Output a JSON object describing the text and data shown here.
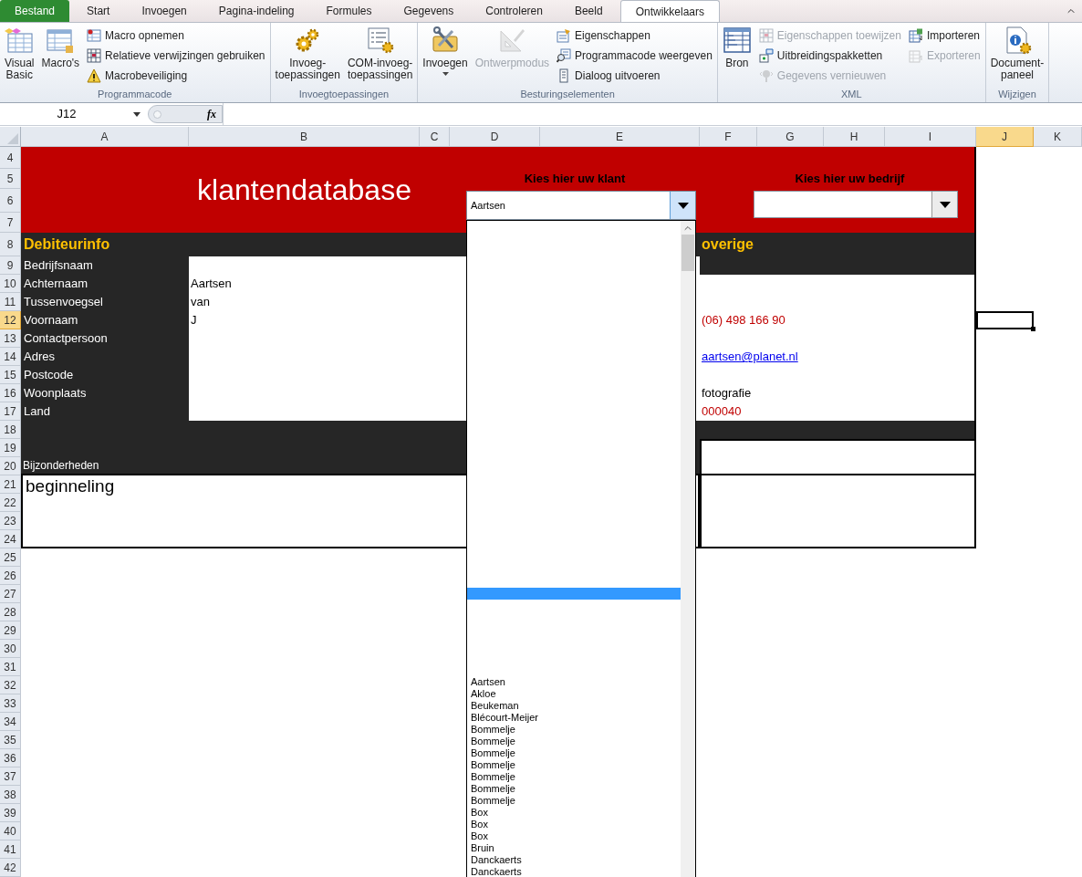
{
  "tabs": [
    {
      "label": "Bestand",
      "kind": "file",
      "selected": false
    },
    {
      "label": "Start",
      "kind": "tab",
      "selected": false
    },
    {
      "label": "Invoegen",
      "kind": "tab",
      "selected": false
    },
    {
      "label": "Pagina-indeling",
      "kind": "tab",
      "selected": false
    },
    {
      "label": "Formules",
      "kind": "tab",
      "selected": false
    },
    {
      "label": "Gegevens",
      "kind": "tab",
      "selected": false
    },
    {
      "label": "Controleren",
      "kind": "tab",
      "selected": false
    },
    {
      "label": "Beeld",
      "kind": "tab",
      "selected": false
    },
    {
      "label": "Ontwikkelaars",
      "kind": "tab",
      "selected": true
    }
  ],
  "ribbon_groups": [
    {
      "title": "Programmacode",
      "items": [
        {
          "lines": [
            "Visual",
            "Basic"
          ],
          "kind": "large",
          "disabled": false
        },
        {
          "lines": [
            "Macro's"
          ],
          "kind": "large",
          "disabled": false
        },
        {
          "lines": [
            "Macro opnemen"
          ],
          "kind": "small",
          "disabled": false
        },
        {
          "lines": [
            "Relatieve verwijzingen gebruiken"
          ],
          "kind": "small",
          "disabled": false
        },
        {
          "lines": [
            "Macrobeveiliging"
          ],
          "kind": "small",
          "disabled": false
        }
      ]
    },
    {
      "title": "Invoegtoepassingen",
      "items": [
        {
          "lines": [
            "Invoeg-",
            "toepassingen"
          ],
          "kind": "large",
          "disabled": false
        },
        {
          "lines": [
            "COM-invoeg-",
            "toepassingen"
          ],
          "kind": "large",
          "disabled": false
        }
      ]
    },
    {
      "title": "Besturingselementen",
      "items": [
        {
          "lines": [
            "Invoegen"
          ],
          "kind": "menu",
          "disabled": false
        },
        {
          "lines": [
            "Ontwerpmodus"
          ],
          "kind": "large",
          "disabled": true
        },
        {
          "lines": [
            "Eigenschappen"
          ],
          "kind": "small",
          "disabled": false
        },
        {
          "lines": [
            "Programmacode weergeven"
          ],
          "kind": "small",
          "disabled": false
        },
        {
          "lines": [
            "Dialoog uitvoeren"
          ],
          "kind": "small",
          "disabled": false
        }
      ]
    },
    {
      "title": "XML",
      "items": [
        {
          "lines": [
            "Bron"
          ],
          "kind": "large",
          "disabled": false
        },
        {
          "lines": [
            "Eigenschappen toewijzen"
          ],
          "kind": "small",
          "disabled": true
        },
        {
          "lines": [
            "Uitbreidingspakketten"
          ],
          "kind": "small",
          "disabled": false
        },
        {
          "lines": [
            "Gegevens vernieuwen"
          ],
          "kind": "small",
          "disabled": true
        },
        {
          "lines": [
            "Importeren"
          ],
          "kind": "small",
          "disabled": false
        },
        {
          "lines": [
            "Exporteren"
          ],
          "kind": "small",
          "disabled": true
        }
      ]
    },
    {
      "title": "Wijzigen",
      "items": [
        {
          "lines": [
            "Document-",
            "paneel"
          ],
          "kind": "large",
          "disabled": false
        }
      ]
    }
  ],
  "formula_bar": {
    "name_box": "J12",
    "function_button": "fx"
  },
  "sheet": {
    "columns": [
      {
        "label": "A",
        "selected": false
      },
      {
        "label": "B",
        "selected": false
      },
      {
        "label": "C",
        "selected": false
      },
      {
        "label": "D",
        "selected": false
      },
      {
        "label": "E",
        "selected": false
      },
      {
        "label": "F",
        "selected": false
      },
      {
        "label": "G",
        "selected": false
      },
      {
        "label": "H",
        "selected": false
      },
      {
        "label": "I",
        "selected": false
      },
      {
        "label": "J",
        "selected": true
      },
      {
        "label": "K",
        "selected": false
      }
    ],
    "rows": [
      {
        "label": "4",
        "selected": false
      },
      {
        "label": "5",
        "selected": false
      },
      {
        "label": "6",
        "selected": false
      },
      {
        "label": "7",
        "selected": false
      },
      {
        "label": "8",
        "selected": false
      },
      {
        "label": "9",
        "selected": false
      },
      {
        "label": "10",
        "selected": false
      },
      {
        "label": "11",
        "selected": false
      },
      {
        "label": "12",
        "selected": true
      },
      {
        "label": "13",
        "selected": false
      },
      {
        "label": "14",
        "selected": false
      },
      {
        "label": "15",
        "selected": false
      },
      {
        "label": "16",
        "selected": false
      },
      {
        "label": "17",
        "selected": false
      },
      {
        "label": "18",
        "selected": false
      },
      {
        "label": "19",
        "selected": false
      },
      {
        "label": "20",
        "selected": false
      },
      {
        "label": "21",
        "selected": false
      },
      {
        "label": "22",
        "selected": false
      },
      {
        "label": "23",
        "selected": false
      },
      {
        "label": "24",
        "selected": false
      },
      {
        "label": "25",
        "selected": false
      },
      {
        "label": "26",
        "selected": false
      },
      {
        "label": "27",
        "selected": false
      },
      {
        "label": "28",
        "selected": false
      },
      {
        "label": "29",
        "selected": false
      },
      {
        "label": "30",
        "selected": false
      },
      {
        "label": "31",
        "selected": false
      },
      {
        "label": "32",
        "selected": false
      },
      {
        "label": "33",
        "selected": false
      },
      {
        "label": "34",
        "selected": false
      },
      {
        "label": "35",
        "selected": false
      },
      {
        "label": "36",
        "selected": false
      },
      {
        "label": "37",
        "selected": false
      },
      {
        "label": "38",
        "selected": false
      },
      {
        "label": "39",
        "selected": false
      },
      {
        "label": "40",
        "selected": false
      },
      {
        "label": "41",
        "selected": false
      },
      {
        "label": "42",
        "selected": false
      }
    ],
    "title": "klantendatabase",
    "customer_picker": {
      "label": "Kies hier uw klant",
      "value": "Aartsen",
      "open": true
    },
    "company_picker": {
      "label": "Kies hier uw bedrijf",
      "open": false
    },
    "debtor_heading": "Debiteurinfo",
    "debtor_fields": [
      {
        "label": "Bedrijfsnaam"
      },
      {
        "label": "Achternaam",
        "value": "Aartsen"
      },
      {
        "label": "Tussenvoegsel",
        "value": "van"
      },
      {
        "label": "Voornaam",
        "value": "J"
      },
      {
        "label": "Contactpersoon"
      },
      {
        "label": "Adres"
      },
      {
        "label": "Postcode"
      },
      {
        "label": "Woonplaats"
      },
      {
        "label": "Land"
      }
    ],
    "other_heading": "overige",
    "other_fields": [
      {
        "kind": "blank"
      },
      {
        "kind": "blank"
      },
      {
        "kind": "red",
        "value": "(06) 498 166 90"
      },
      {
        "kind": "blank"
      },
      {
        "kind": "link",
        "value": "aartsen@planet.nl"
      },
      {
        "kind": "blank"
      },
      {
        "kind": "text",
        "value": "fotografie"
      },
      {
        "kind": "red",
        "value": "000040"
      }
    ],
    "remarks_label": "Bijzonderheden",
    "remarks_text": "beginneling"
  },
  "customer_list": {
    "blank_entry_selected": true,
    "items": [
      {
        "text": "Aartsen",
        "selected": false
      },
      {
        "text": "Akloe",
        "selected": false
      },
      {
        "text": "Beukeman",
        "selected": false
      },
      {
        "text": "Blécourt-Meijer",
        "selected": false
      },
      {
        "text": "Bommelje",
        "selected": false
      },
      {
        "text": "Bommelje",
        "selected": false
      },
      {
        "text": "Bommelje",
        "selected": false
      },
      {
        "text": "Bommelje",
        "selected": false
      },
      {
        "text": "Bommelje",
        "selected": false
      },
      {
        "text": "Bommelje",
        "selected": false
      },
      {
        "text": "Bommelje",
        "selected": false
      },
      {
        "text": "Box",
        "selected": false
      },
      {
        "text": "Box",
        "selected": false
      },
      {
        "text": "Box",
        "selected": false
      },
      {
        "text": "Bruin",
        "selected": false
      },
      {
        "text": "Danckaerts",
        "selected": false
      },
      {
        "text": "Danckaerts",
        "selected": false
      }
    ]
  }
}
